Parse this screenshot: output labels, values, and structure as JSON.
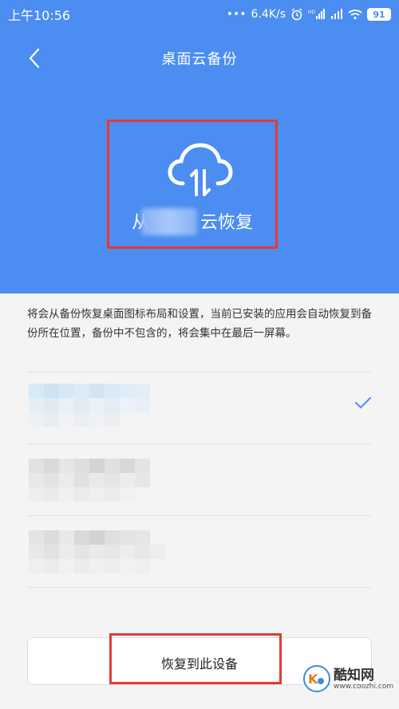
{
  "status_bar": {
    "time": "上午10:56",
    "dots": "•••",
    "speed": "6.4K/s",
    "battery": "91"
  },
  "nav": {
    "title": "桌面云备份"
  },
  "hero": {
    "label_prefix": "从",
    "label_suffix": "云恢复",
    "icon": "cloud-sync-icon"
  },
  "description": "将会从备份恢复桌面图标布局和设置，当前已安装的应用会自动恢复到备份所在位置，备份中不包含的，将会集中在最后一屏幕。",
  "devices": [
    {
      "selected": true
    },
    {
      "selected": false
    },
    {
      "selected": false
    }
  ],
  "restore_button": {
    "label": "恢复到此设备"
  },
  "watermark": {
    "name": "酷知网",
    "url": "www.coozhi.com"
  },
  "colors": {
    "header_bg": "#4b8df0",
    "highlight": "#e53935",
    "check": "#4b8df0"
  }
}
